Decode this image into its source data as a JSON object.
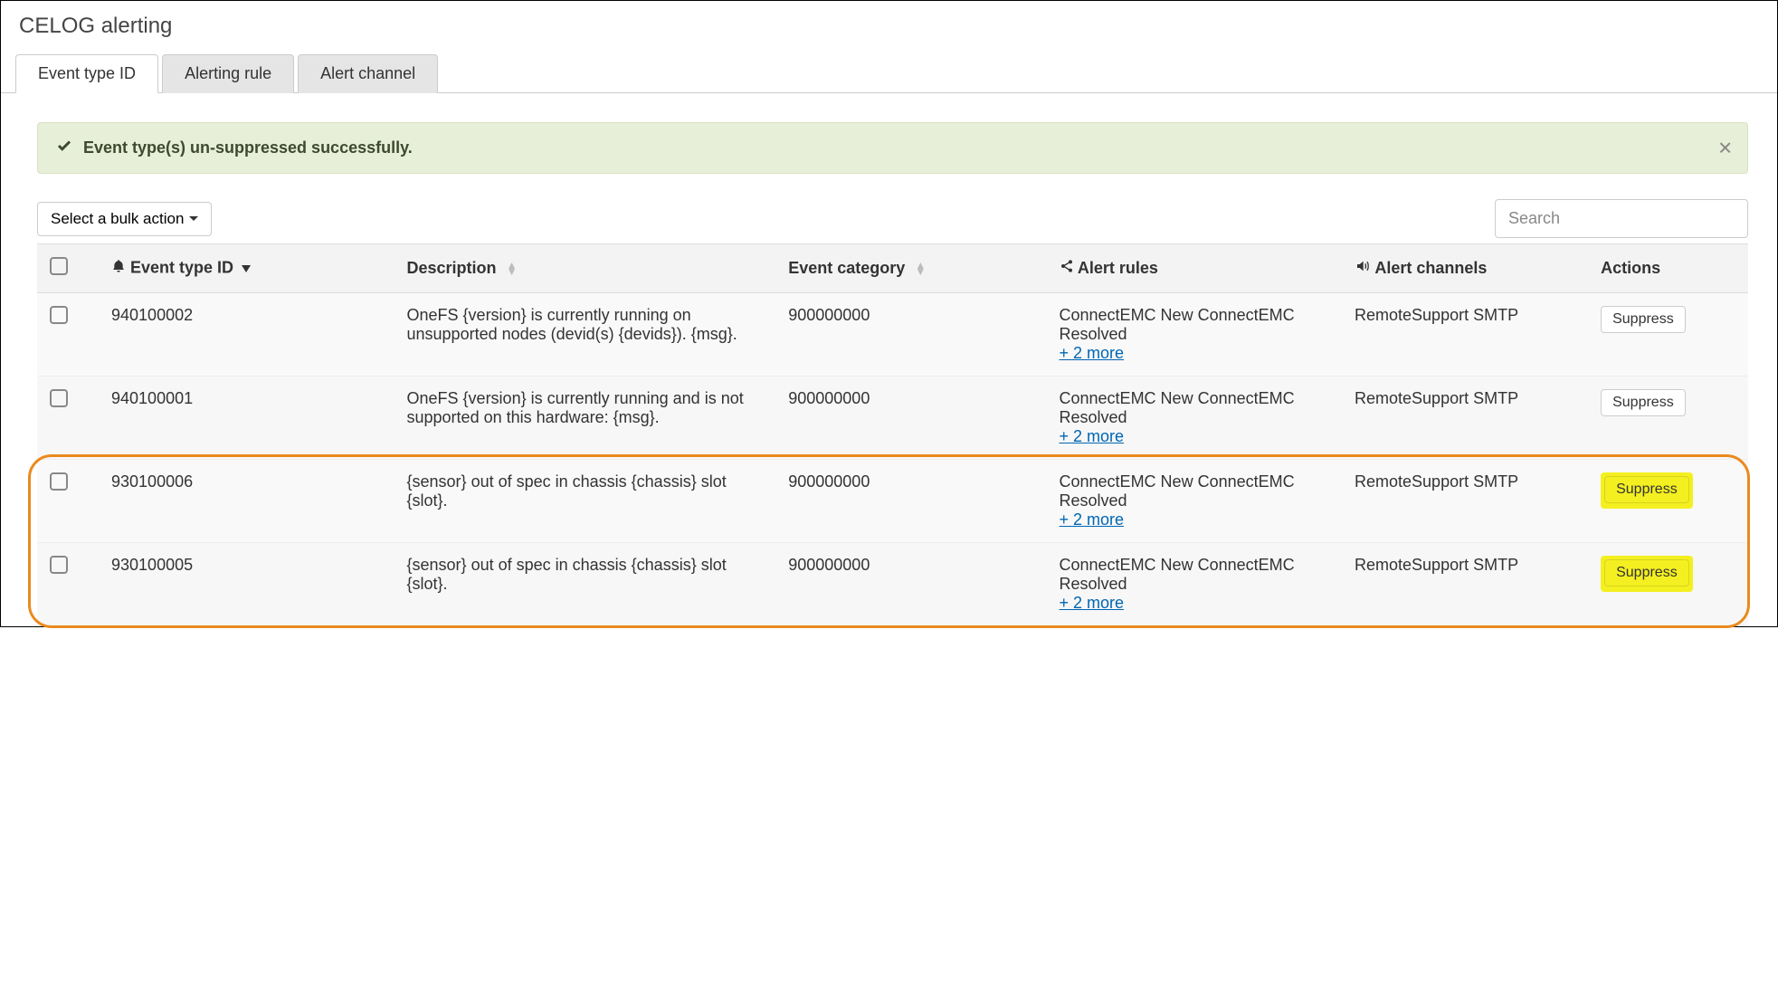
{
  "page_title": "CELOG alerting",
  "tabs": [
    {
      "label": "Event type ID",
      "active": true
    },
    {
      "label": "Alerting rule",
      "active": false
    },
    {
      "label": "Alert channel",
      "active": false
    }
  ],
  "alert_banner": {
    "text": "Event type(s) un-suppressed successfully."
  },
  "toolbar": {
    "bulk_label": "Select a bulk action",
    "search_placeholder": "Search"
  },
  "columns": {
    "id": "Event type ID",
    "desc": "Description",
    "cat": "Event category",
    "rules": "Alert rules",
    "chan": "Alert channels",
    "act": "Actions"
  },
  "more_link": "+ 2 more",
  "action_label": "Suppress",
  "rows": [
    {
      "id": "940100002",
      "desc": "OneFS {version} is currently running on unsupported nodes (devid(s) {devids}). {msg}.",
      "cat": "900000000",
      "rules": "ConnectEMC New ConnectEMC Resolved",
      "chan": "RemoteSupport SMTP",
      "highlight": false
    },
    {
      "id": "940100001",
      "desc": "OneFS {version} is currently running and is not supported on this hardware: {msg}.",
      "cat": "900000000",
      "rules": "ConnectEMC New ConnectEMC Resolved",
      "chan": "RemoteSupport SMTP",
      "highlight": false
    },
    {
      "id": "930100006",
      "desc": "{sensor} out of spec in chassis {chassis} slot {slot}.",
      "cat": "900000000",
      "rules": "ConnectEMC New ConnectEMC Resolved",
      "chan": "RemoteSupport SMTP",
      "highlight": true
    },
    {
      "id": "930100005",
      "desc": "{sensor} out of spec in chassis {chassis} slot {slot}.",
      "cat": "900000000",
      "rules": "ConnectEMC New ConnectEMC Resolved",
      "chan": "RemoteSupport SMTP",
      "highlight": true
    }
  ],
  "colors": {
    "callout": "#ea8a1d",
    "highlight": "#f4ef20",
    "banner_bg": "#e8efd9",
    "link": "#0066b3"
  }
}
